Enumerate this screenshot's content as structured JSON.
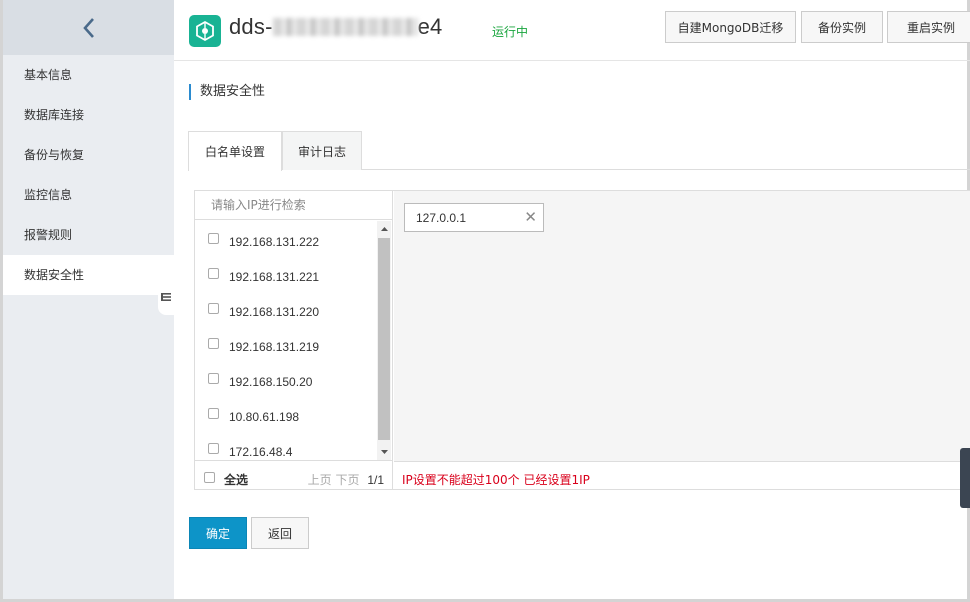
{
  "sidebar": {
    "items": [
      {
        "label": "基本信息"
      },
      {
        "label": "数据库连接"
      },
      {
        "label": "备份与恢复"
      },
      {
        "label": "监控信息"
      },
      {
        "label": "报警规则"
      },
      {
        "label": "数据安全性"
      }
    ],
    "active_index": 5
  },
  "header": {
    "instance_prefix": "dds-",
    "instance_suffix": "e4",
    "status": "运行中",
    "buttons": [
      "自建MongoDB迁移",
      "备份实例",
      "重启实例"
    ]
  },
  "section_title": "数据安全性",
  "tabs": [
    {
      "label": "白名单设置",
      "active": true
    },
    {
      "label": "审计日志",
      "active": false
    }
  ],
  "whitelist": {
    "search_placeholder": "请输入IP进行检索",
    "candidates": [
      "192.168.131.222",
      "192.168.131.221",
      "192.168.131.220",
      "192.168.131.219",
      "192.168.150.20",
      "10.80.61.198",
      "172.16.48.4"
    ],
    "select_all_label": "全选",
    "prev_label": "上页",
    "next_label": "下页",
    "page_text": "1/1",
    "selected": [
      "127.0.0.1"
    ],
    "warning": "IP设置不能超过100个 已经设置1IP"
  },
  "actions": {
    "confirm": "确定",
    "back": "返回"
  },
  "colors": {
    "accent": "#0d94c8",
    "status_green": "#19a53e",
    "warning_red": "#d9001b",
    "logo_green": "#19b394"
  }
}
